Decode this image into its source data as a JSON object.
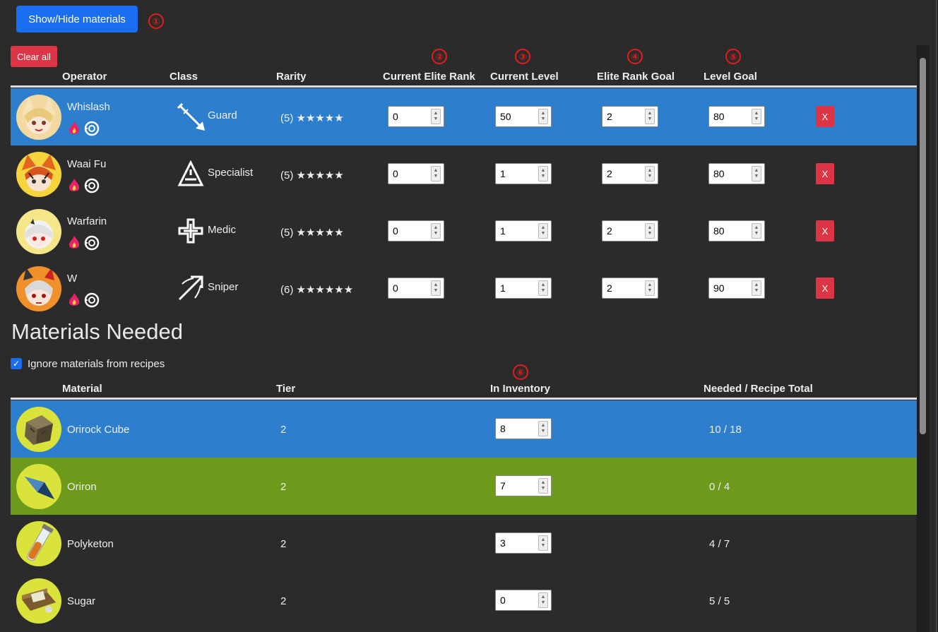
{
  "toolbar": {
    "show_hide_label": "Show/Hide materials",
    "clear_all_label": "Clear all"
  },
  "annotations": [
    "①",
    "②",
    "③",
    "④",
    "⑤",
    "⑥"
  ],
  "operator_headers": {
    "operator": "Operator",
    "class": "Class",
    "rarity": "Rarity",
    "current_elite": "Current Elite Rank",
    "current_level": "Current Level",
    "elite_goal": "Elite Rank Goal",
    "level_goal": "Level Goal"
  },
  "operators": [
    {
      "name": "Whislash",
      "class": "Guard",
      "rarity": "(5) ★★★★★",
      "current_elite": "0",
      "current_level": "50",
      "elite_goal": "2",
      "level_goal": "80",
      "remove": "X",
      "class_icon": "guard-icon"
    },
    {
      "name": "Waai Fu",
      "class": "Specialist",
      "rarity": "(5) ★★★★★",
      "current_elite": "0",
      "current_level": "1",
      "elite_goal": "2",
      "level_goal": "80",
      "remove": "X",
      "class_icon": "specialist-icon"
    },
    {
      "name": "Warfarin",
      "class": "Medic",
      "rarity": "(5) ★★★★★",
      "current_elite": "0",
      "current_level": "1",
      "elite_goal": "2",
      "level_goal": "80",
      "remove": "X",
      "class_icon": "medic-icon"
    },
    {
      "name": "W",
      "class": "Sniper",
      "rarity": "(6) ★★★★★★",
      "current_elite": "0",
      "current_level": "1",
      "elite_goal": "2",
      "level_goal": "90",
      "remove": "X",
      "class_icon": "sniper-icon"
    }
  ],
  "materials_section": {
    "title": "Materials Needed",
    "ignore_recipes_label": "Ignore materials from recipes",
    "ignore_recipes_checked": true
  },
  "material_headers": {
    "material": "Material",
    "tier": "Tier",
    "inventory": "In Inventory",
    "needed": "Needed / Recipe Total"
  },
  "materials": [
    {
      "name": "Orirock Cube",
      "tier": "2",
      "inventory": "8",
      "needed": "10 / 18"
    },
    {
      "name": "Oriron",
      "tier": "2",
      "inventory": "7",
      "needed": "0 / 4"
    },
    {
      "name": "Polyketon",
      "tier": "2",
      "inventory": "3",
      "needed": "4 / 7"
    },
    {
      "name": "Sugar",
      "tier": "2",
      "inventory": "0",
      "needed": "5 / 5"
    }
  ],
  "colors": {
    "primary": "#1a6ff0",
    "danger": "#dc3545",
    "row_highlight_blue": "#2d7ecd",
    "row_highlight_green": "#6e9a1b",
    "annotation_red": "#e51c1c"
  }
}
